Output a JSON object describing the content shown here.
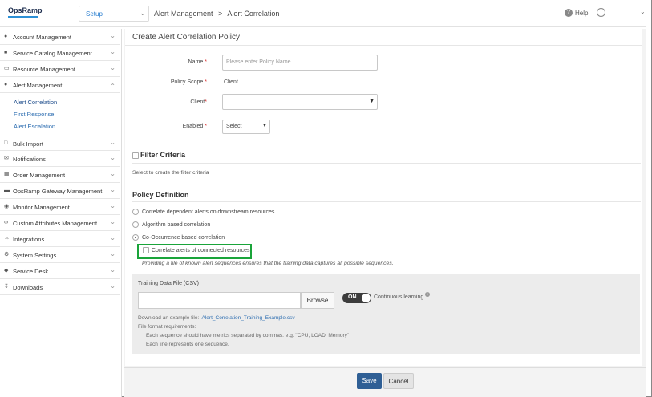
{
  "app": {
    "logo": "OpsRamp"
  },
  "header": {
    "module_select": "Setup",
    "breadcrumb": [
      "Alert Management",
      ">",
      "Alert Correlation"
    ],
    "help_label": "Help"
  },
  "sidebar": {
    "items": [
      {
        "label": "Account Management",
        "icon": "user-icon"
      },
      {
        "label": "Service Catalog Management",
        "icon": "catalog-icon"
      },
      {
        "label": "Resource Management",
        "icon": "monitor-icon"
      },
      {
        "label": "Alert Management",
        "icon": "user-icon",
        "expanded": true
      },
      {
        "label": "Bulk Import",
        "icon": "import-icon"
      },
      {
        "label": "Notifications",
        "icon": "envelope-icon"
      },
      {
        "label": "Order Management",
        "icon": "order-icon"
      },
      {
        "label": "OpsRamp Gateway Management",
        "icon": "gateway-icon"
      },
      {
        "label": "Monitor Management",
        "icon": "eye-icon"
      },
      {
        "label": "Custom Attributes Management",
        "icon": "attributes-icon"
      },
      {
        "label": "Integrations",
        "icon": "integrations-icon"
      },
      {
        "label": "System Settings",
        "icon": "gear-icon"
      },
      {
        "label": "Service Desk",
        "icon": "tag-icon"
      },
      {
        "label": "Downloads",
        "icon": "download-icon"
      }
    ],
    "subitems": [
      "Alert Correlation",
      "First Response",
      "Alert Escalation"
    ]
  },
  "form": {
    "title": "Create Alert Correlation Policy",
    "name_label": "Name",
    "name_placeholder": "Please enter Policy Name",
    "scope_label": "Policy Scope",
    "scope_value": "Client",
    "client_label": "Client",
    "client_value": "",
    "enabled_label": "Enabled",
    "enabled_value": "Select",
    "required_mark": "*"
  },
  "filter": {
    "title": "Filter Criteria",
    "hint": "Select to create the filter criteria"
  },
  "policy": {
    "title": "Policy Definition",
    "options": [
      "Correlate dependent alerts on downstream resources",
      "Algorithm based correlation",
      "Co-Occurrence based correlation"
    ],
    "selected_index": 2,
    "connected_label": "Correlate alerts of connected resources",
    "sequence_hint": "Providing a file of known alert sequences ensures that the training data captures all possible sequences."
  },
  "training": {
    "label": "Training Data File (CSV)",
    "browse": "Browse",
    "toggle_state": "ON",
    "continuous_label": "Continuous learning",
    "download_prefix": "Download an example file:",
    "download_link": "Alert_Correlation_Training_Example.csv",
    "requirements_title": "File format requirements:",
    "requirement_1": "Each sequence should have metrics separated by commas. e.g. \"CPU, LOAD, Memory\"",
    "requirement_2": "Each line represents one sequence."
  },
  "actions": {
    "save": "Save",
    "cancel": "Cancel"
  },
  "colors": {
    "accent": "#2f5f95",
    "highlight": "#1aa43a",
    "link": "#2b6cb0"
  }
}
